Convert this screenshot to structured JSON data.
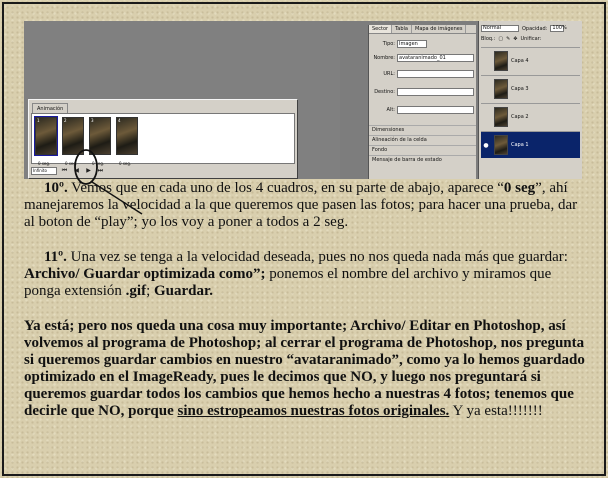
{
  "ui": {
    "anim_tab": "Animación",
    "frames": [
      {
        "num": "1",
        "time": "0 seg."
      },
      {
        "num": "2",
        "time": "0 seg."
      },
      {
        "num": "3",
        "time": "0 seg."
      },
      {
        "num": "4",
        "time": "0 seg."
      }
    ],
    "loop": "Infinito",
    "slice_tabs": [
      "Sector",
      "Tabla",
      "Mapa de imágenes"
    ],
    "fields": {
      "tipo_label": "Tipo:",
      "tipo_value": "Imagen",
      "nombre_label": "Nombre:",
      "nombre_value": "avataranimado_01",
      "url_label": "URL:",
      "destino_label": "Destino:",
      "alt_label": "Alt:"
    },
    "sections": [
      "Dimensiones",
      "Alineación de la celda",
      "Fondo",
      "Mensaje de barra de estado"
    ],
    "blend_mode": "Normal",
    "opacity_label": "Opacidad:",
    "opacity_value": "100%",
    "lock_label": "Bloq.:",
    "unify_label": "Unificar:",
    "layers": [
      "Capa 4",
      "Capa 3",
      "Capa 2",
      "Capa 1"
    ]
  },
  "text": {
    "p1_num": "10º.",
    "p1_a": " Vemos que en cada uno de los 4 cuadros, en su parte de abajo, aparece “",
    "p1_b": "0 seg",
    "p1_c": "”, ahí manejaremos la velocidad a la que queremos que pasen las fotos; para hacer una prueba, dar al boton de “play”; yo los voy a poner a todos a 2 seg.",
    "p2_num": "11º.",
    "p2_a": " Una vez se tenga a la velocidad deseada, pues no nos queda nada más que guardar: ",
    "p2_b": "Archivo/ Guardar optimizada como”;",
    "p2_c": " ponemos el nombre del archivo y miramos que ponga extensión ",
    "p2_d": ".gif",
    "p2_e": ";  ",
    "p2_f": "Guardar.",
    "p3_a": "Ya está; pero nos queda una cosa muy importante; Archivo/ Editar en Photoshop, así volvemos al programa de Photoshop; al cerrar el programa de Photoshop, nos pregunta si queremos guardar cambios en nuestro “avataranimado”, como ya lo hemos guardado optimizado en el ImageReady, pues le decimos que NO, y luego nos preguntará si queremos guardar todos los cambios que hemos hecho a nuestras 4 fotos; tenemos que decirle que NO, porque ",
    "p3_b": "sino estropeamos nuestras fotos originales.",
    "p3_c": "  Y ya esta!!!!!!!"
  }
}
